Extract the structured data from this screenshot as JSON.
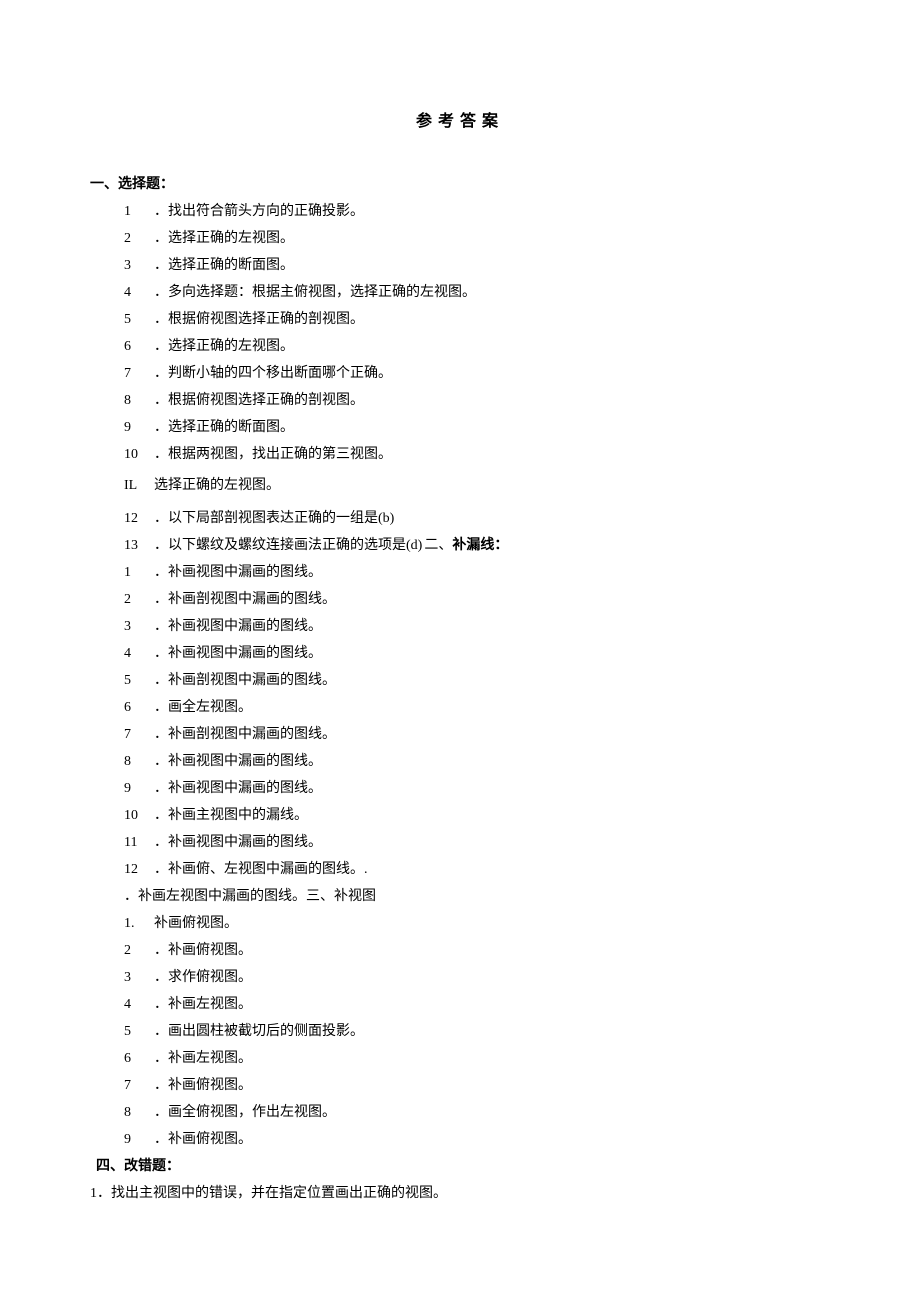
{
  "title": "参考答案",
  "section1": {
    "heading": "一、选择题：",
    "items": [
      {
        "num": "1",
        "text": "．找出符合箭头方向的正确投影。"
      },
      {
        "num": "2",
        "text": "．选择正确的左视图。"
      },
      {
        "num": "3",
        "text": "．选择正确的断面图。"
      },
      {
        "num": "4",
        "text": "．多向选择题：根据主俯视图，选择正确的左视图。"
      },
      {
        "num": "5",
        "text": "．根据俯视图选择正确的剖视图。"
      },
      {
        "num": "6",
        "text": "．选择正确的左视图。"
      },
      {
        "num": "7",
        "text": "．判断小轴的四个移出断面哪个正确。"
      },
      {
        "num": "8",
        "text": "．根据俯视图选择正确的剖视图。"
      },
      {
        "num": "9",
        "text": "．选择正确的断面图。"
      },
      {
        "num": "10",
        "text": "．根据两视图，找出正确的第三视图。"
      }
    ],
    "il": {
      "label": "IL",
      "text": "选择正确的左视图。"
    },
    "item12": {
      "num": "12",
      "text": "．以下局部剖视图表达正确的一组是(b)"
    },
    "item13": {
      "num": "13",
      "text_part1": "．以下螺纹及螺纹连接画法正确的选项是(d)",
      "text_part2": "二、",
      "text_part3": "补漏线："
    }
  },
  "section2": {
    "items": [
      {
        "num": "1",
        "text": "．补画视图中漏画的图线。"
      },
      {
        "num": "2",
        "text": "．补画剖视图中漏画的图线。"
      },
      {
        "num": "3",
        "text": "．补画视图中漏画的图线。"
      },
      {
        "num": "4",
        "text": "．补画视图中漏画的图线。"
      },
      {
        "num": "5",
        "text": "．补画剖视图中漏画的图线。"
      },
      {
        "num": "6",
        "text": "．画全左视图。"
      },
      {
        "num": "7",
        "text": "．补画剖视图中漏画的图线。"
      },
      {
        "num": "8",
        "text": "．补画视图中漏画的图线。"
      },
      {
        "num": "9",
        "text": "．补画视图中漏画的图线。"
      },
      {
        "num": "10",
        "text": "．补画主视图中的漏线。"
      },
      {
        "num": "11",
        "text": "．补画视图中漏画的图线。"
      },
      {
        "num": "12",
        "text": "．补画俯、左视图中漏画的图线。."
      }
    ],
    "trailing": "．补画左视图中漏画的图线。三、补视图"
  },
  "section3": {
    "items": [
      {
        "num": "1.",
        "text": "补画俯视图。"
      },
      {
        "num": "2",
        "text": "．补画俯视图。"
      },
      {
        "num": "3",
        "text": "．求作俯视图。"
      },
      {
        "num": "4",
        "text": "．补画左视图。"
      },
      {
        "num": "5",
        "text": "．画出圆柱被截切后的侧面投影。"
      },
      {
        "num": "6",
        "text": "．补画左视图。"
      },
      {
        "num": "7",
        "text": "．补画俯视图。"
      },
      {
        "num": "8",
        "text": "．画全俯视图，作出左视图。"
      },
      {
        "num": "9",
        "text": "．补画俯视图。"
      }
    ]
  },
  "section4": {
    "heading": "四、改错题：",
    "item": {
      "num": "1",
      "text": "．找出主视图中的错误，并在指定位置画出正确的视图。"
    }
  }
}
